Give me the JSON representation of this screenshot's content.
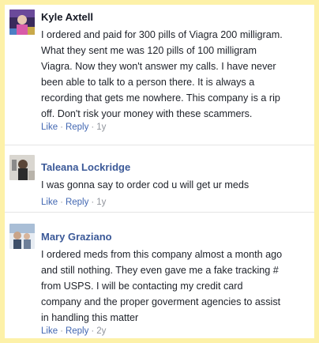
{
  "comments": [
    {
      "author": "Kyle Axtell",
      "lines": [
        "I ordered and paid for 300 pills of Viagra 200 milligram.",
        "What they sent me was 120 pills of 100 milligram",
        "Viagra. Now they won't answer my calls. I have never",
        "been able to talk to a person there. It is always a",
        "recording that gets me nowhere. This company is a rip",
        "off. Don't risk your money with these scammers."
      ],
      "like_label": "Like",
      "reply_label": "Reply",
      "separator": "·",
      "age": "1y"
    },
    {
      "author": "Taleana Lockridge",
      "lines": [
        "I was gonna say to order cod u will get ur meds"
      ],
      "like_label": "Like",
      "reply_label": "Reply",
      "separator": "·",
      "age": "1y"
    },
    {
      "author": "Mary Graziano",
      "lines": [
        "I ordered meds from this company almost a month ago",
        "and still nothing. They even gave me a fake tracking #",
        "from USPS. I will be contacting my credit card",
        "company and the proper goverment agencies to assist",
        "in handling this matter"
      ],
      "like_label": "Like",
      "reply_label": "Reply",
      "separator": "·",
      "age": "2y"
    }
  ],
  "colors": {
    "frame": "#fdf1a8",
    "link": "#4267b2",
    "author": "#3b5998",
    "meta": "#90949c"
  }
}
